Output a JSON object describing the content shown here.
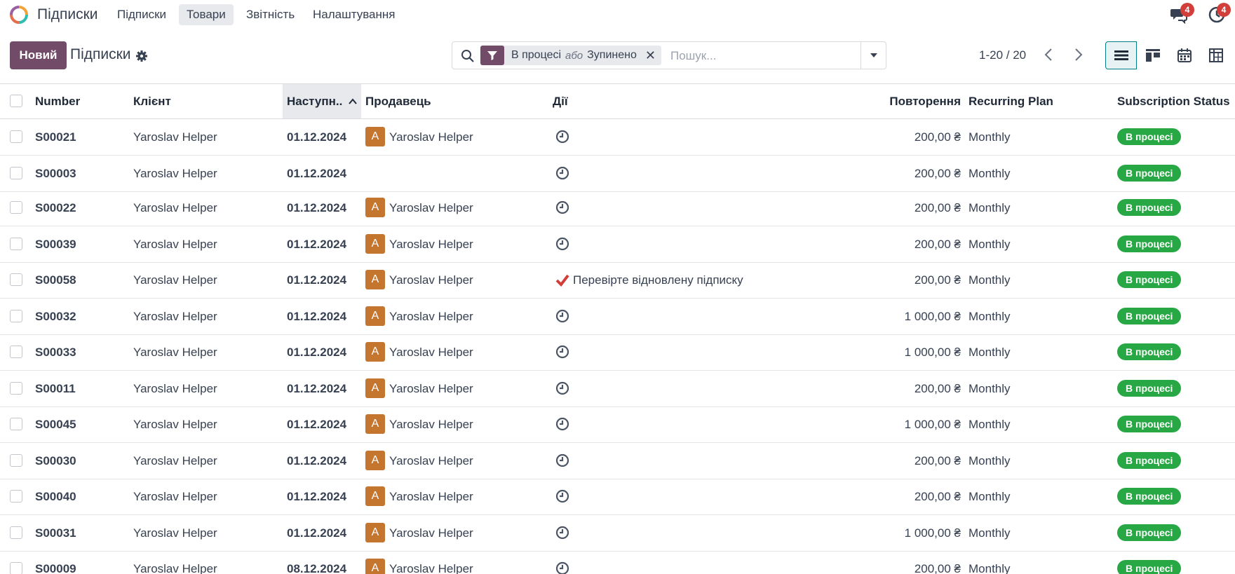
{
  "navbar": {
    "app_name": "Підписки",
    "menu": [
      "Підписки",
      "Товари",
      "Звітність",
      "Налаштування"
    ],
    "messages_badge": "4",
    "activities_badge": "4"
  },
  "control": {
    "new_button": "Новий",
    "breadcrumb": "Підписки",
    "facet_a": "В процесі",
    "facet_or": "або",
    "facet_b": "Зупинено",
    "search_placeholder": "Пошук...",
    "pager": "1-20 / 20"
  },
  "columns": {
    "number": "Number",
    "client": "Клієнт",
    "next": "Наступн..",
    "seller": "Продавець",
    "activities": "Дії",
    "recurring": "Повторення",
    "plan": "Recurring Plan",
    "status": "Subscription Status"
  },
  "rows": [
    {
      "number": "S00021",
      "client": "Yaroslav Helper",
      "date": "01.12.2024",
      "avatar": "A",
      "seller": "Yaroslav Helper",
      "activity": "",
      "amount": "200,00 ₴",
      "plan": "Monthly",
      "status": "В процесі"
    },
    {
      "number": "S00003",
      "client": "Yaroslav Helper",
      "date": "01.12.2024",
      "avatar": "",
      "seller": "",
      "activity": "",
      "amount": "200,00 ₴",
      "plan": "Monthly",
      "status": "В процесі"
    },
    {
      "number": "S00022",
      "client": "Yaroslav Helper",
      "date": "01.12.2024",
      "avatar": "A",
      "seller": "Yaroslav Helper",
      "activity": "",
      "amount": "200,00 ₴",
      "plan": "Monthly",
      "status": "В процесі"
    },
    {
      "number": "S00039",
      "client": "Yaroslav Helper",
      "date": "01.12.2024",
      "avatar": "A",
      "seller": "Yaroslav Helper",
      "activity": "",
      "amount": "200,00 ₴",
      "plan": "Monthly",
      "status": "В процесі"
    },
    {
      "number": "S00058",
      "client": "Yaroslav Helper",
      "date": "01.12.2024",
      "avatar": "A",
      "seller": "Yaroslav Helper",
      "activity": "Перевірте відновлену підписку",
      "amount": "200,00 ₴",
      "plan": "Monthly",
      "status": "В процесі"
    },
    {
      "number": "S00032",
      "client": "Yaroslav Helper",
      "date": "01.12.2024",
      "avatar": "A",
      "seller": "Yaroslav Helper",
      "activity": "",
      "amount": "1 000,00 ₴",
      "plan": "Monthly",
      "status": "В процесі"
    },
    {
      "number": "S00033",
      "client": "Yaroslav Helper",
      "date": "01.12.2024",
      "avatar": "A",
      "seller": "Yaroslav Helper",
      "activity": "",
      "amount": "1 000,00 ₴",
      "plan": "Monthly",
      "status": "В процесі"
    },
    {
      "number": "S00011",
      "client": "Yaroslav Helper",
      "date": "01.12.2024",
      "avatar": "A",
      "seller": "Yaroslav Helper",
      "activity": "",
      "amount": "200,00 ₴",
      "plan": "Monthly",
      "status": "В процесі"
    },
    {
      "number": "S00045",
      "client": "Yaroslav Helper",
      "date": "01.12.2024",
      "avatar": "A",
      "seller": "Yaroslav Helper",
      "activity": "",
      "amount": "1 000,00 ₴",
      "plan": "Monthly",
      "status": "В процесі"
    },
    {
      "number": "S00030",
      "client": "Yaroslav Helper",
      "date": "01.12.2024",
      "avatar": "A",
      "seller": "Yaroslav Helper",
      "activity": "",
      "amount": "200,00 ₴",
      "plan": "Monthly",
      "status": "В процесі"
    },
    {
      "number": "S00040",
      "client": "Yaroslav Helper",
      "date": "01.12.2024",
      "avatar": "A",
      "seller": "Yaroslav Helper",
      "activity": "",
      "amount": "200,00 ₴",
      "plan": "Monthly",
      "status": "В процесі"
    },
    {
      "number": "S00031",
      "client": "Yaroslav Helper",
      "date": "01.12.2024",
      "avatar": "A",
      "seller": "Yaroslav Helper",
      "activity": "",
      "amount": "1 000,00 ₴",
      "plan": "Monthly",
      "status": "В процесі"
    },
    {
      "number": "S00009",
      "client": "Yaroslav Helper",
      "date": "08.12.2024",
      "avatar": "A",
      "seller": "Yaroslav Helper",
      "activity": "",
      "amount": "200,00 ₴",
      "plan": "Monthly",
      "status": "В процесі"
    }
  ]
}
